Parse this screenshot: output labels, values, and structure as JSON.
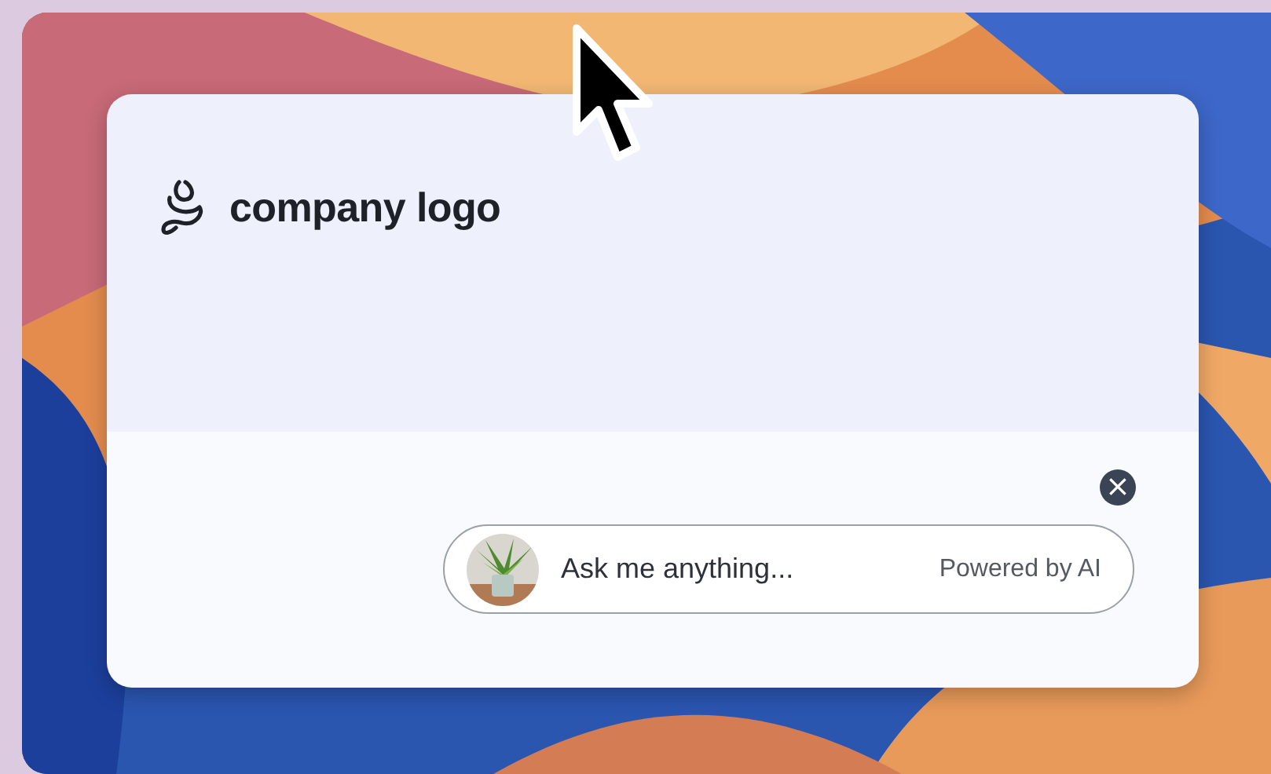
{
  "logo": {
    "text": "company logo"
  },
  "chat": {
    "close": "×",
    "placeholder": "Ask me anything...",
    "powered_by": "Powered by AI"
  }
}
